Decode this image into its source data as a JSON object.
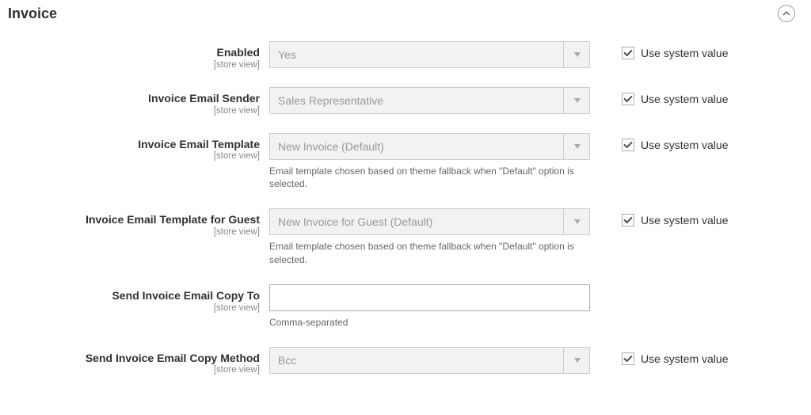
{
  "section": {
    "title": "Invoice"
  },
  "common": {
    "scope": "[store view]",
    "use_system_value": "Use system value"
  },
  "fields": {
    "enabled": {
      "label": "Enabled",
      "value": "Yes"
    },
    "sender": {
      "label": "Invoice Email Sender",
      "value": "Sales Representative"
    },
    "template": {
      "label": "Invoice Email Template",
      "value": "New Invoice (Default)",
      "note": "Email template chosen based on theme fallback when \"Default\" option is selected."
    },
    "guest_template": {
      "label": "Invoice Email Template for Guest",
      "value": "New Invoice for Guest (Default)",
      "note": "Email template chosen based on theme fallback when \"Default\" option is selected."
    },
    "copy_to": {
      "label": "Send Invoice Email Copy To",
      "value": "",
      "note": "Comma-separated"
    },
    "copy_method": {
      "label": "Send Invoice Email Copy Method",
      "value": "Bcc"
    }
  }
}
